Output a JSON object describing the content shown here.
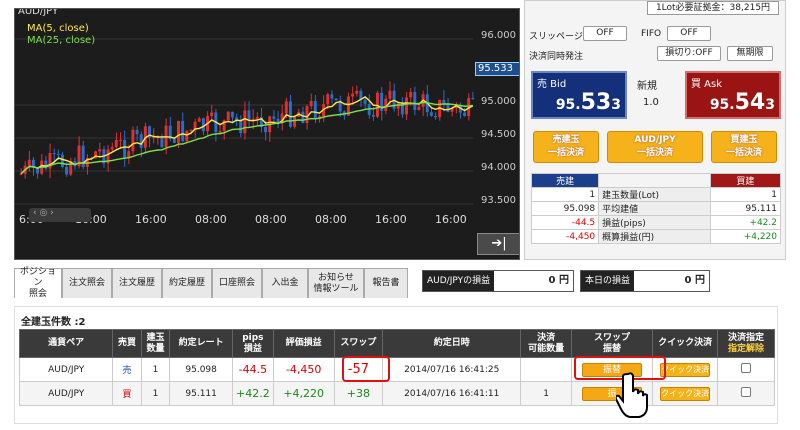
{
  "chart": {
    "pair": "AUD/JPY",
    "ma5": "MA(5, close)",
    "ma25": "MA(25, close)",
    "price_labels": [
      "96.000",
      "95.000",
      "94.500",
      "94.000",
      "93.500"
    ],
    "current_price": "95.533",
    "time_labels": [
      "6:00",
      "16:00",
      "16:00",
      "08:00",
      "08:00",
      "08:00",
      "16:00",
      "16:00"
    ],
    "zoom_icons": "‹ ◎ ›",
    "scroll_button": "➔|",
    "colors": {
      "up": "#e23030",
      "down": "#2a6ec8",
      "ma5": "#ffe94a",
      "ma25": "#7ee04a"
    }
  },
  "panel": {
    "top_info": "1Lot必要証拠金：38,215円",
    "slippage_label": "スリッページ",
    "slippage_value": "OFF",
    "fifo_label": "FIFO",
    "fifo_value": "OFF",
    "simultaneous_label": "決済同時発注",
    "trail_button": "損切り:OFF",
    "indefinite_button": "無期限",
    "bid_label": "売 Bid",
    "bid_prefix": "95.",
    "bid_big": "53",
    "bid_suffix": "3",
    "new_label": "新規",
    "spread": "1.0",
    "ask_label": "買 Ask",
    "ask_prefix": "95.",
    "ask_big": "54",
    "ask_suffix": "3",
    "sell_settle_l1": "売建玉",
    "sell_settle_l2": "一括決済",
    "pair_settle_l1": "AUD/JPY",
    "pair_settle_l2": "一括決済",
    "buy_settle_l1": "買建玉",
    "buy_settle_l2": "一括決済",
    "table": {
      "sell_header": "売建",
      "buy_header": "買建",
      "rows": [
        {
          "sell": "1",
          "label": "建玉数量(Lot)",
          "buy": "1"
        },
        {
          "sell": "95.098",
          "label": "平均建値",
          "buy": "95.111"
        },
        {
          "sell": "-44.5",
          "label": "損益(pips)",
          "buy": "+42.2"
        },
        {
          "sell": "-4,450",
          "label": "概算損益(円)",
          "buy": "+4,220"
        }
      ]
    }
  },
  "tabs": [
    {
      "label1": "ポジション",
      "label2": "照会"
    },
    {
      "label1": "注文照会",
      "label2": ""
    },
    {
      "label1": "注文履歴",
      "label2": ""
    },
    {
      "label1": "約定履歴",
      "label2": ""
    },
    {
      "label1": "口座照会",
      "label2": ""
    },
    {
      "label1": "入出金",
      "label2": ""
    },
    {
      "label1": "お知らせ",
      "label2": "情報ツール"
    },
    {
      "label1": "報告書",
      "label2": ""
    }
  ],
  "pl": {
    "pair_label": "AUD/JPYの損益",
    "pair_value": "0 円",
    "today_label": "本日の損益",
    "today_value": "0 円"
  },
  "positions": {
    "count_label": "全建玉件数 :2",
    "headers": [
      {
        "l1": "通貨ペア",
        "l2": ""
      },
      {
        "l1": "売買",
        "l2": ""
      },
      {
        "l1": "建玉",
        "l2": "数量"
      },
      {
        "l1": "約定レート",
        "l2": ""
      },
      {
        "l1": "pips",
        "l2": "損益"
      },
      {
        "l1": "評価損益",
        "l2": ""
      },
      {
        "l1": "スワップ",
        "l2": ""
      },
      {
        "l1": "約定日時",
        "l2": ""
      },
      {
        "l1": "決済",
        "l2": "可能数量"
      },
      {
        "l1": "スワップ",
        "l2": "振替"
      },
      {
        "l1": "クイック決済",
        "l2": ""
      },
      {
        "l1": "決済指定",
        "l2": "指定解除"
      }
    ],
    "rows": [
      {
        "pair": "AUD/JPY",
        "side": "売",
        "qty": "1",
        "rate": "95.098",
        "pips": "-44.5",
        "pl": "-4,450",
        "swap": "-57",
        "datetime": "2014/07/16 16:41:25",
        "settle_qty": "",
        "swap_btn": "振替",
        "quick_btn": "クイック決済"
      },
      {
        "pair": "AUD/JPY",
        "side": "買",
        "qty": "1",
        "rate": "95.111",
        "pips": "+42.2",
        "pl": "+4,220",
        "swap": "+38",
        "datetime": "2014/07/16 16:41:11",
        "settle_qty": "1",
        "swap_btn": "振",
        "quick_btn": "クイック決済"
      }
    ]
  }
}
